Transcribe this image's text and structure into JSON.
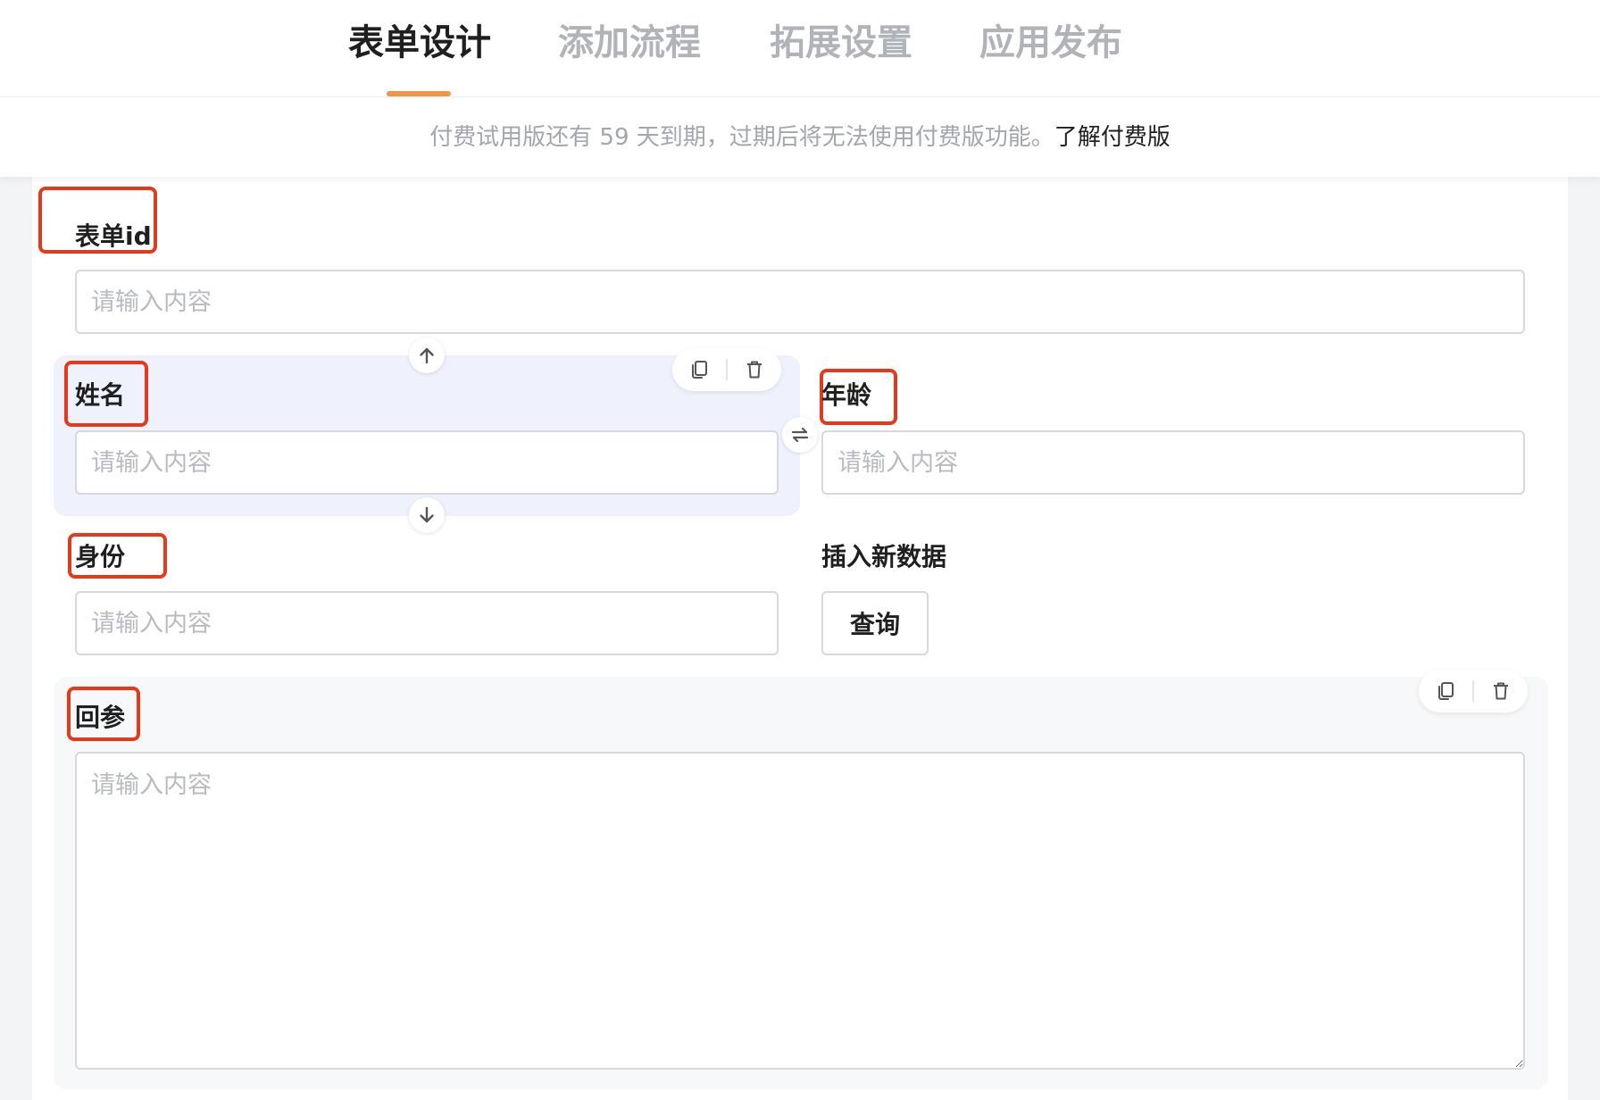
{
  "tabs": [
    {
      "label": "表单设计",
      "active": true
    },
    {
      "label": "添加流程",
      "active": false
    },
    {
      "label": "拓展设置",
      "active": false
    },
    {
      "label": "应用发布",
      "active": false
    }
  ],
  "notice": {
    "text": "付费试用版还有 59 天到期，过期后将无法使用付费版功能。",
    "link": "了解付费版"
  },
  "form": {
    "form_id": {
      "label": "表单id",
      "placeholder": "请输入内容"
    },
    "name": {
      "label": "姓名",
      "placeholder": "请输入内容"
    },
    "age": {
      "label": "年龄",
      "placeholder": "请输入内容"
    },
    "identity": {
      "label": "身份",
      "placeholder": "请输入内容"
    },
    "insert": {
      "label": "插入新数据",
      "button": "查询"
    },
    "return_params": {
      "label": "回参",
      "placeholder": "请输入内容"
    }
  },
  "colors": {
    "accent": "#f0954a",
    "annotation": "#e5391c",
    "selected_field_bg": "#eff1fc"
  },
  "icons": [
    "copy-icon",
    "trash-icon",
    "arrow-up-icon",
    "arrow-down-icon",
    "swap-icon"
  ]
}
